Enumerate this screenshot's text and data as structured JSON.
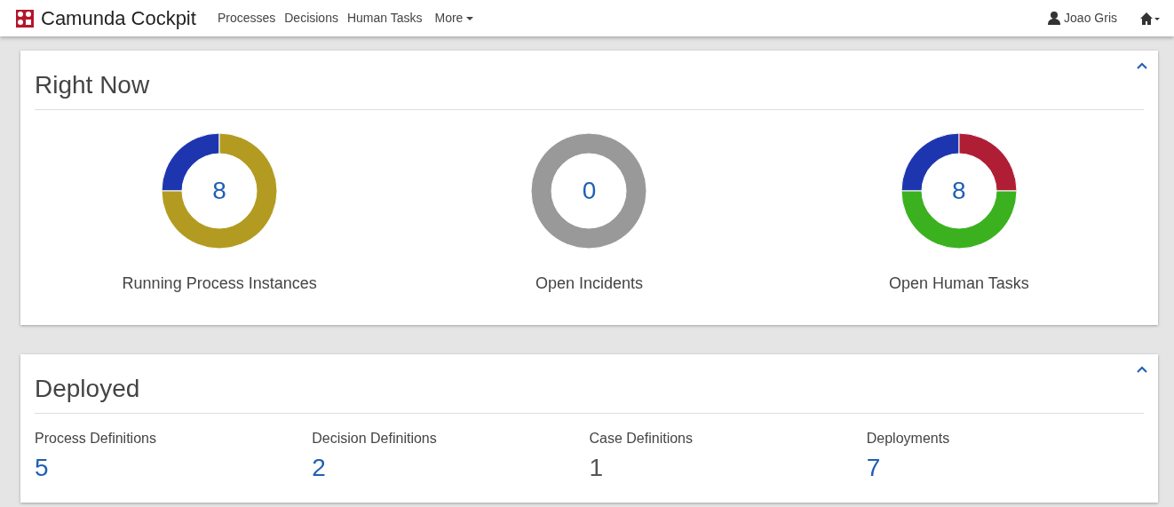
{
  "navbar": {
    "brand": "Camunda Cockpit",
    "links": [
      "Processes",
      "Decisions",
      "Human Tasks"
    ],
    "more": "More",
    "user": "Joao Gris"
  },
  "right_now": {
    "title": "Right Now",
    "items": [
      {
        "count": "8",
        "label": "Running Process Instances"
      },
      {
        "count": "0",
        "label": "Open Incidents"
      },
      {
        "count": "8",
        "label": "Open Human Tasks"
      }
    ]
  },
  "deployed": {
    "title": "Deployed",
    "items": [
      {
        "label": "Process Definitions",
        "count": "5",
        "muted": false
      },
      {
        "label": "Decision Definitions",
        "count": "2",
        "muted": false
      },
      {
        "label": "Case Definitions",
        "count": "1",
        "muted": true
      },
      {
        "label": "Deployments",
        "count": "7",
        "muted": false
      }
    ]
  }
}
